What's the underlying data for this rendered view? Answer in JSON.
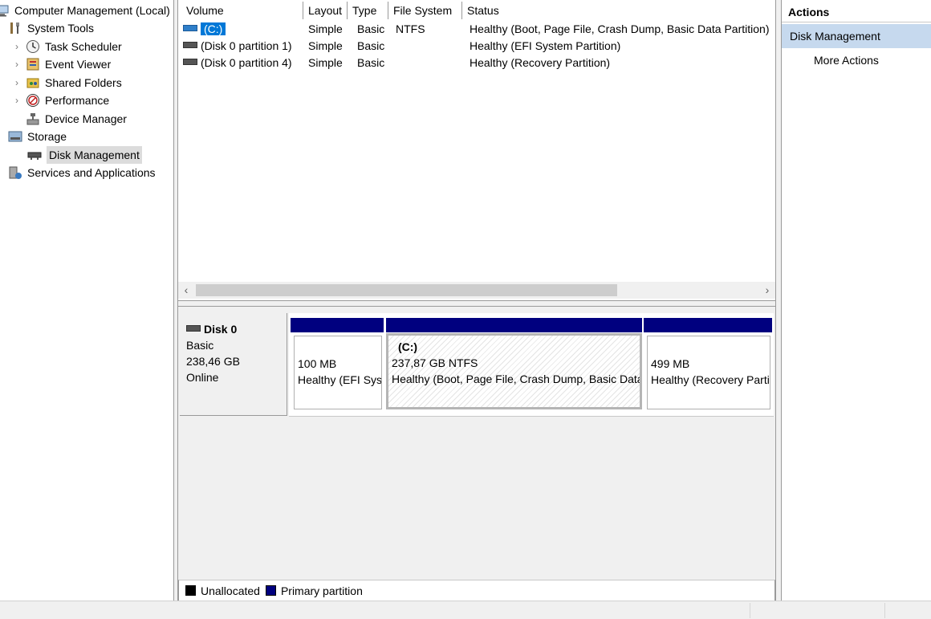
{
  "tree": {
    "root": "Computer Management (Local)",
    "items": [
      {
        "label": "System Tools",
        "icon": "tools-icon",
        "expander": "",
        "level": 1
      },
      {
        "label": "Task Scheduler",
        "icon": "clock-icon",
        "expander": "›",
        "level": 2
      },
      {
        "label": "Event Viewer",
        "icon": "event-viewer-icon",
        "expander": "›",
        "level": 2
      },
      {
        "label": "Shared Folders",
        "icon": "shared-folders-icon",
        "expander": "›",
        "level": 2
      },
      {
        "label": "Performance",
        "icon": "performance-icon",
        "expander": "›",
        "level": 2
      },
      {
        "label": "Device Manager",
        "icon": "device-manager-icon",
        "expander": "",
        "level": 2
      },
      {
        "label": "Storage",
        "icon": "storage-icon",
        "expander": "",
        "level": 1
      },
      {
        "label": "Disk Management",
        "icon": "disk-management-icon",
        "expander": "",
        "level": 2,
        "selected": true
      },
      {
        "label": "Services and Applications",
        "icon": "services-icon",
        "expander": "",
        "level": 1
      }
    ]
  },
  "volumes": {
    "columns": [
      "Volume",
      "Layout",
      "Type",
      "File System",
      "Status"
    ],
    "rows": [
      {
        "volume": "(C:)",
        "layout": "Simple",
        "type": "Basic",
        "fs": "NTFS",
        "status": "Healthy (Boot, Page File, Crash Dump, Basic Data Partition)"
      },
      {
        "volume": "(Disk 0 partition 1)",
        "layout": "Simple",
        "type": "Basic",
        "fs": "",
        "status": "Healthy (EFI System Partition)"
      },
      {
        "volume": "(Disk 0 partition 4)",
        "layout": "Simple",
        "type": "Basic",
        "fs": "",
        "status": "Healthy (Recovery Partition)"
      }
    ],
    "scroll_left": "‹",
    "scroll_right": "›"
  },
  "disk": {
    "name": "Disk 0",
    "kind": "Basic",
    "size": "238,46 GB",
    "state": "Online",
    "partitions": [
      {
        "title": "",
        "size": "100 MB",
        "status": "Healthy (EFI System Partition)"
      },
      {
        "title": "(C:)",
        "size": "237,87 GB NTFS",
        "status": "Healthy (Boot, Page File, Crash Dump, Basic Data Partition)"
      },
      {
        "title": "",
        "size": "499 MB",
        "status": "Healthy (Recovery Partition)"
      }
    ]
  },
  "legend": {
    "unallocated": "Unallocated",
    "primary": "Primary partition",
    "unallocated_color": "#000000",
    "primary_color": "#00007f"
  },
  "actions": {
    "header": "Actions",
    "section": "Disk Management",
    "more": "More Actions"
  }
}
